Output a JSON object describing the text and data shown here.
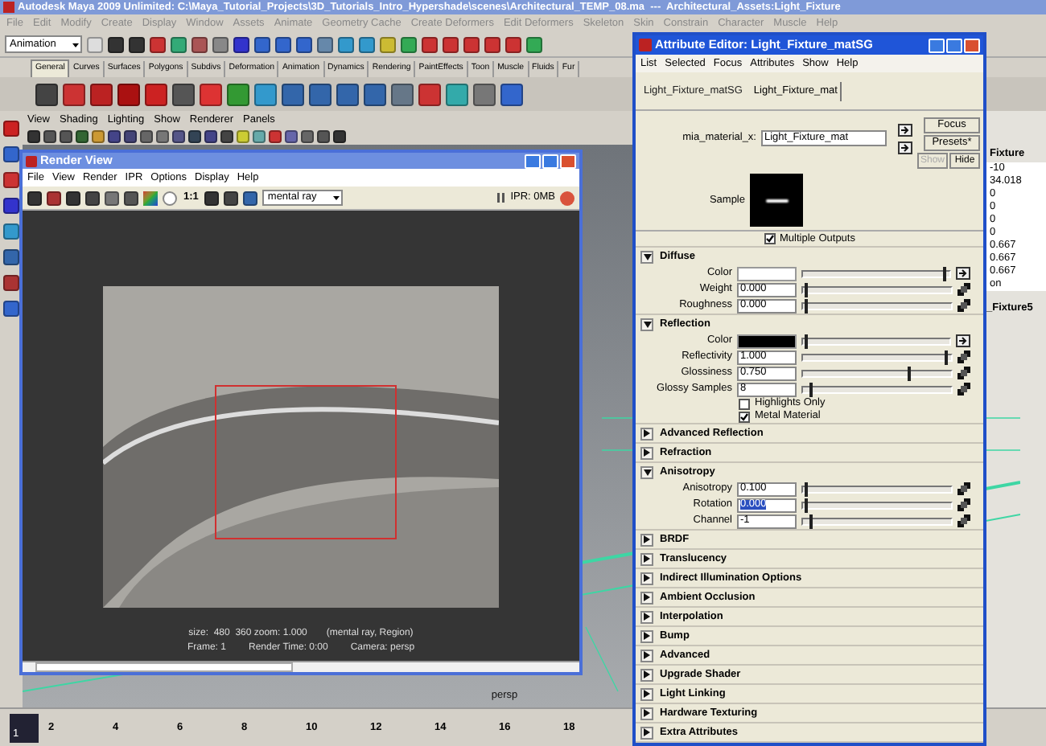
{
  "main_window": {
    "title": "Autodesk Maya 2009 Unlimited: C:\\Maya_Tutorial_Projects\\3D_Tutorials_Intro_Hypershade\\scenes\\Architectural_TEMP_08.ma  ---  Architectural_Assets:Light_Fixture",
    "menu": [
      "File",
      "Edit",
      "Modify",
      "Create",
      "Display",
      "Window",
      "Assets",
      "Animate",
      "Geometry Cache",
      "Create Deformers",
      "Edit Deformers",
      "Skeleton",
      "Skin",
      "Constrain",
      "Character",
      "Muscle",
      "Help"
    ],
    "mode_dropdown": "Animation",
    "shelf_tabs": [
      {
        "label": "General",
        "selected": true
      },
      {
        "label": "Curves",
        "selected": false
      },
      {
        "label": "Surfaces",
        "selected": false
      },
      {
        "label": "Polygons",
        "selected": false
      },
      {
        "label": "Subdivs",
        "selected": false
      },
      {
        "label": "Deformation",
        "selected": false
      },
      {
        "label": "Animation",
        "selected": false
      },
      {
        "label": "Dynamics",
        "selected": false
      },
      {
        "label": "Rendering",
        "selected": false
      },
      {
        "label": "PaintEffects",
        "selected": false
      },
      {
        "label": "Toon",
        "selected": false
      },
      {
        "label": "Muscle",
        "selected": false
      },
      {
        "label": "Fluids",
        "selected": false
      },
      {
        "label": "Fur",
        "selected": false
      }
    ],
    "panel_menu": [
      "View",
      "Shading",
      "Lighting",
      "Show",
      "Renderer",
      "Panels"
    ],
    "viewport_label": "persp",
    "current_frame": "1",
    "timeline_ticks": [
      "2",
      "4",
      "6",
      "8",
      "10",
      "12",
      "14",
      "16",
      "18"
    ]
  },
  "channel_box": {
    "header": "Fixture",
    "values": [
      "-10",
      "34.018",
      "0",
      "0",
      "0",
      "0",
      "0.667",
      "0.667",
      "0.667",
      "on"
    ],
    "footer": "_Fixture5"
  },
  "render_view": {
    "title": "Render View",
    "menu": [
      "File",
      "View",
      "Render",
      "IPR",
      "Options",
      "Display",
      "Help"
    ],
    "ratio_button": "1:1",
    "renderer": "mental ray",
    "ipr_memory": "IPR: 0MB",
    "size_info": "size:  480  360 zoom: 1.000",
    "region_info": "(mental ray, Region)",
    "frame": "Frame: 1",
    "render_time": "Render Time: 0:00",
    "camera": "Camera: persp"
  },
  "attribute_editor": {
    "title": "Attribute Editor: Light_Fixture_matSG",
    "menu": [
      "List",
      "Selected",
      "Focus",
      "Attributes",
      "Show",
      "Help"
    ],
    "tabs": [
      {
        "label": "Light_Fixture_matSG",
        "selected": false
      },
      {
        "label": "Light_Fixture_mat",
        "selected": true
      }
    ],
    "node_type": "mia_material_x:",
    "node_name": "Light_Fixture_mat",
    "buttons": [
      {
        "label": "Focus",
        "disabled": false
      },
      {
        "label": "Presets*",
        "disabled": false
      },
      {
        "label": "Show",
        "disabled": true
      },
      {
        "label": "Hide",
        "disabled": false
      }
    ],
    "sample_label": "Sample",
    "multiple_outputs": {
      "label": "Multiple Outputs",
      "checked": true
    },
    "sections": [
      {
        "title": "Diffuse",
        "expanded": true,
        "rows": [
          {
            "kind": "color",
            "label": "Color",
            "color": "#ffffff",
            "level": 0.97
          },
          {
            "kind": "number",
            "label": "Weight",
            "value": "0.000",
            "level": 0.02,
            "selected": false
          },
          {
            "kind": "number",
            "label": "Roughness",
            "value": "0.000",
            "level": 0.02,
            "selected": false
          }
        ]
      },
      {
        "title": "Reflection",
        "expanded": true,
        "rows": [
          {
            "kind": "color",
            "label": "Color",
            "color": "#000000",
            "level": 0.02
          },
          {
            "kind": "number",
            "label": "Reflectivity",
            "value": "1.000",
            "level": 0.97,
            "selected": false
          },
          {
            "kind": "number",
            "label": "Glossiness",
            "value": "0.750",
            "level": 0.72,
            "selected": false
          },
          {
            "kind": "number",
            "label": "Glossy Samples",
            "value": "8",
            "level": 0.05,
            "selected": false
          },
          {
            "kind": "checkbox",
            "label": "Highlights Only",
            "checked": false
          },
          {
            "kind": "checkbox",
            "label": "Metal Material",
            "checked": true
          }
        ]
      },
      {
        "title": "Advanced Reflection",
        "expanded": false
      },
      {
        "title": "Refraction",
        "expanded": false
      },
      {
        "title": "Anisotropy",
        "expanded": true,
        "rows": [
          {
            "kind": "number",
            "label": "Anisotropy",
            "value": "0.100",
            "level": 0.02,
            "selected": false
          },
          {
            "kind": "number",
            "label": "Rotation",
            "value": "0.000",
            "level": 0.02,
            "selected": true
          },
          {
            "kind": "number",
            "label": "Channel",
            "value": "-1",
            "level": 0.05,
            "selected": false
          }
        ]
      },
      {
        "title": "BRDF",
        "expanded": false
      },
      {
        "title": "Translucency",
        "expanded": false
      },
      {
        "title": "Indirect Illumination Options",
        "expanded": false
      },
      {
        "title": "Ambient Occlusion",
        "expanded": false
      },
      {
        "title": "Interpolation",
        "expanded": false
      },
      {
        "title": "Bump",
        "expanded": false
      },
      {
        "title": "Advanced",
        "expanded": false
      },
      {
        "title": "Upgrade Shader",
        "expanded": false
      },
      {
        "title": "Light Linking",
        "expanded": false
      },
      {
        "title": "Hardware Texturing",
        "expanded": false
      },
      {
        "title": "Extra Attributes",
        "expanded": false
      }
    ]
  }
}
